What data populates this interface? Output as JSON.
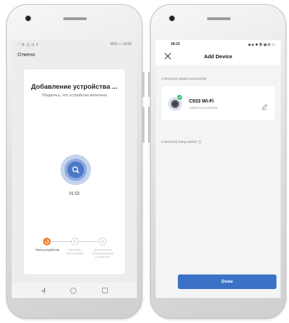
{
  "left_phone": {
    "status_bar": {
      "icons": ".⫶ 令 ◫ ◷ ⚲",
      "battery": "82% ▭ 13:06"
    },
    "cancel_label": "Отмена",
    "card": {
      "title": "Добавление устройства ...",
      "subtitle": "Убедитесь, что устройство включено",
      "timer": "01:53"
    },
    "steps": [
      {
        "label": "Поиск устройства",
        "state": "active"
      },
      {
        "label": "Облачная регистрация",
        "state": "idle"
      },
      {
        "label": "Выполняется инициализация устройства",
        "state": "idle"
      }
    ],
    "colors": {
      "accent": "#4e79c9",
      "step_active": "#f08230"
    }
  },
  "right_phone": {
    "status_bar": {
      "time": "09:23",
      "icons": "◙ ◈ ✱ 令 ▣ ⊪ ▭"
    },
    "header": {
      "title": "Add Device"
    },
    "added_label": "1 device(s) added successfully",
    "device": {
      "name": "C933 Wi-Fi",
      "status": "Added successfully"
    },
    "adding_label": "0 device(s) being added",
    "done_label": "Done",
    "colors": {
      "primary": "#3b72c6",
      "success": "#2fb86a"
    }
  }
}
